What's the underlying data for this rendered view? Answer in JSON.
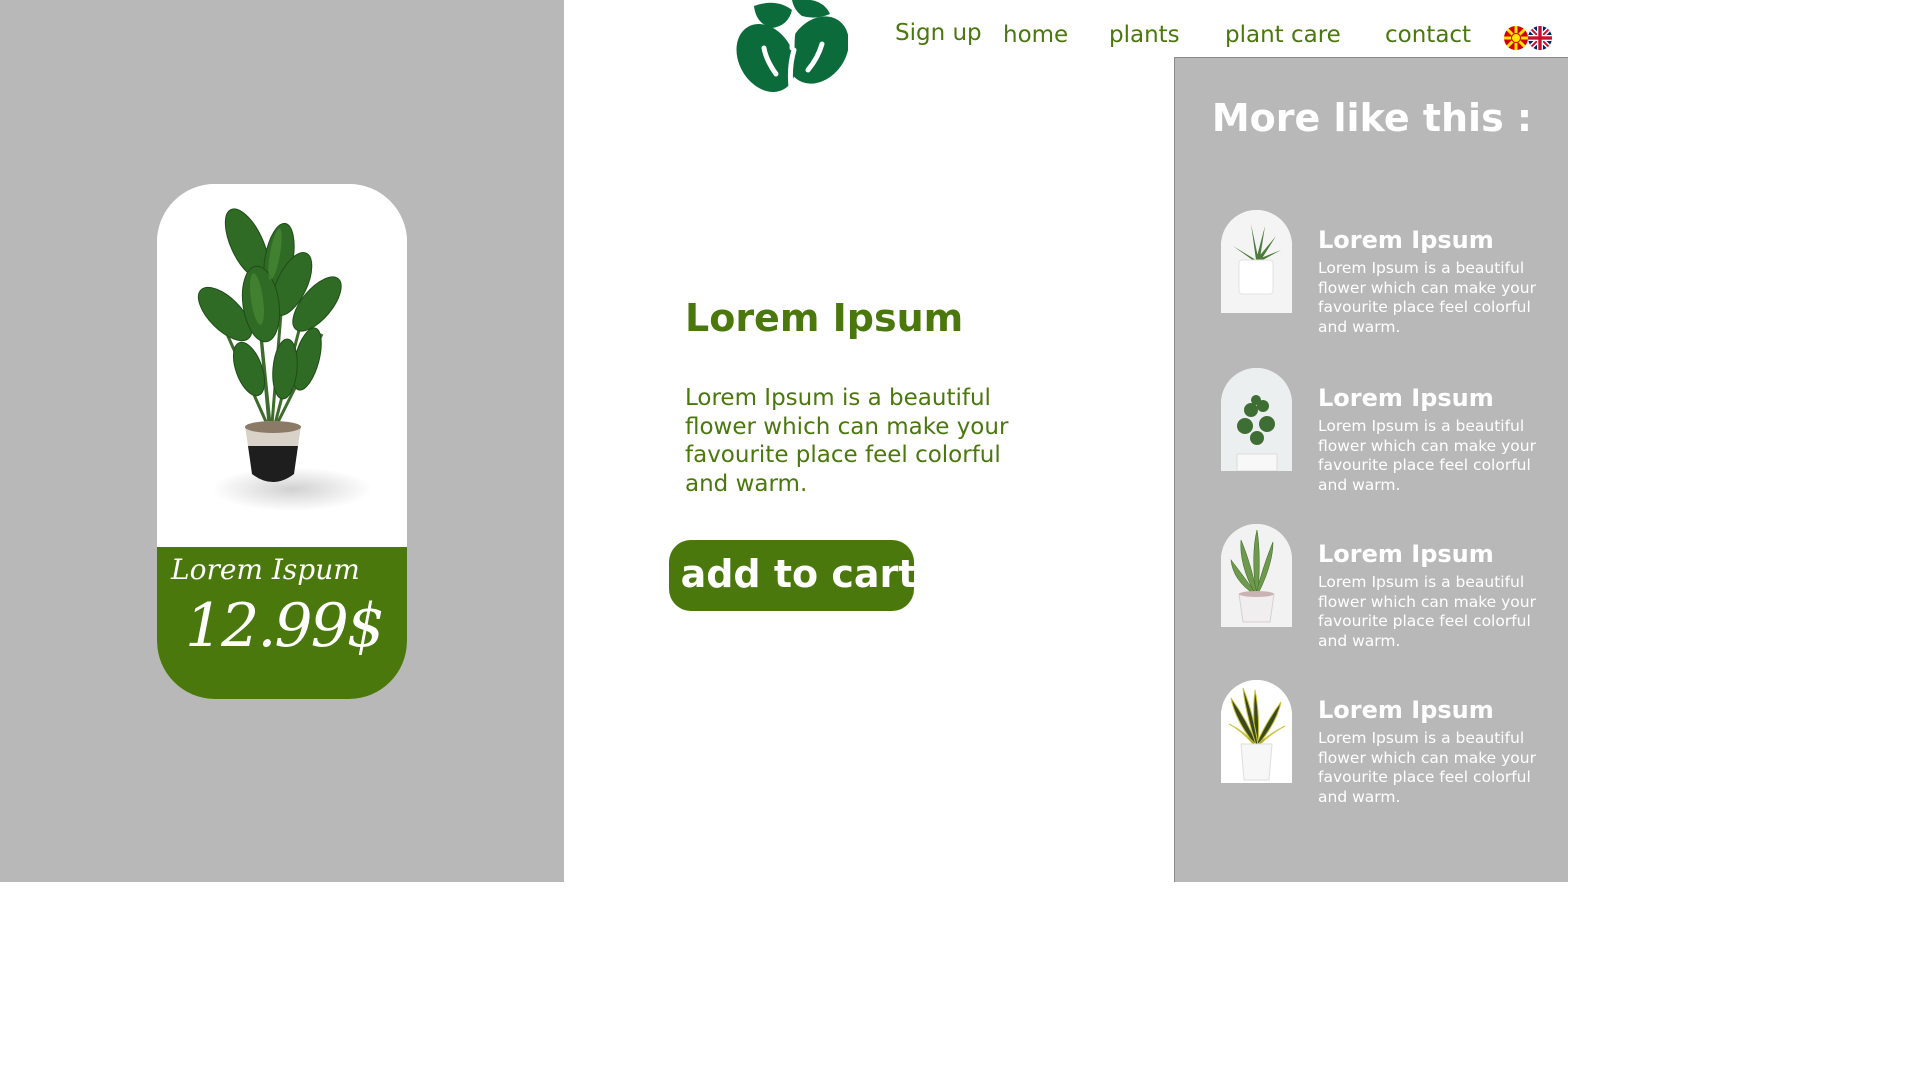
{
  "nav": {
    "signup": "Sign up",
    "home": "home",
    "plants": "plants",
    "plant_care": "plant care",
    "contact": "contact",
    "languages": [
      "mk-flag-icon",
      "uk-flag-icon"
    ]
  },
  "product_card": {
    "name": "Lorem Ispum",
    "price": "12.99$"
  },
  "product": {
    "title": "Lorem Ipsum",
    "description": "Lorem Ipsum is a beautiful flower which can make your favourite place feel colorful and warm.",
    "add_to_cart": "add to cart"
  },
  "sidebar": {
    "title": "More like this :",
    "items": [
      {
        "title": "Lorem Ipsum",
        "description": "Lorem Ipsum is a beautiful flower which can make your favourite place feel colorful and warm."
      },
      {
        "title": "Lorem Ipsum",
        "description": "Lorem Ipsum is a beautiful flower which can make your favourite place feel colorful and warm."
      },
      {
        "title": "Lorem Ipsum",
        "description": "Lorem Ipsum is a beautiful flower which can make your favourite place feel colorful and warm."
      },
      {
        "title": "Lorem Ipsum",
        "description": "Lorem Ipsum is a beautiful flower which can make your favourite place feel colorful and warm."
      }
    ]
  },
  "colors": {
    "brand_green": "#4a780c",
    "logo_green": "#0b6b3a",
    "panel_grey": "#b8b8b8"
  }
}
